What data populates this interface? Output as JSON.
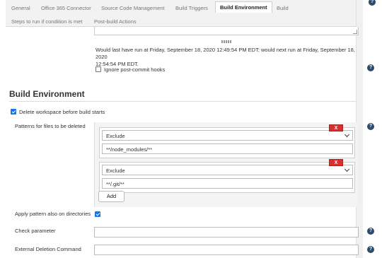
{
  "tabs": [
    {
      "label": "General"
    },
    {
      "label": "Office 365 Connector"
    },
    {
      "label": "Source Code Management"
    },
    {
      "label": "Build Triggers"
    },
    {
      "label": "Build Environment"
    },
    {
      "label": "Build"
    },
    {
      "label": "Steps to run if condition is met"
    },
    {
      "label": "Post-build Actions"
    }
  ],
  "active_tab": "Build Environment",
  "schedule": {
    "line1": "Would last have run at Friday, September 18, 2020 12:49:54 PM EDT; would next run at Friday, September 18, 2020",
    "line2": "12:54:54 PM EDT."
  },
  "ignore_hooks": {
    "label": "Ignore post-commit hooks",
    "checked": false
  },
  "section": {
    "title": "Build Environment"
  },
  "delete_workspace": {
    "label": "Delete workspace before build starts",
    "checked": true
  },
  "patterns": {
    "label": "Patterns for files to be deleted",
    "items": [
      {
        "type": "Exclude",
        "pattern": "**/node_modules/**",
        "delete_label": "X"
      },
      {
        "type": "Exclude",
        "pattern": "**/.git/**",
        "delete_label": "X"
      }
    ],
    "add_label": "Add"
  },
  "apply_dirs": {
    "label": "Apply pattern also on directories",
    "checked": true
  },
  "check_parameter": {
    "label": "Check parameter",
    "value": ""
  },
  "external_command": {
    "label": "External Deletion Command",
    "value": ""
  },
  "help_glyph": "?",
  "colors": {
    "delete_button": "#d9302c",
    "checkbox": "#1a73e8",
    "help_icon": "#2c4a6b"
  }
}
